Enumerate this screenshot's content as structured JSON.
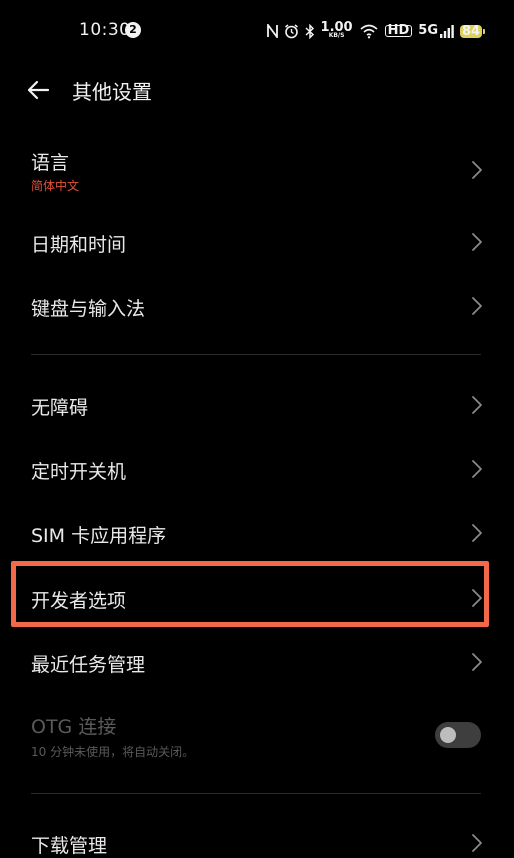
{
  "status_bar": {
    "time": "10:30",
    "notification_count": "2",
    "net_speed_value": "1.00",
    "net_speed_unit": "KB/S",
    "hd_label": "HD",
    "signal_5g": "5G",
    "battery_level": "84"
  },
  "header": {
    "title": "其他设置"
  },
  "items": [
    {
      "label": "语言",
      "sub": "简体中文"
    },
    {
      "label": "日期和时间"
    },
    {
      "label": "键盘与输入法"
    },
    {
      "label": "无障碍"
    },
    {
      "label": "定时开关机"
    },
    {
      "label": "SIM 卡应用程序"
    },
    {
      "label": "开发者选项"
    },
    {
      "label": "最近任务管理"
    },
    {
      "label": "OTG 连接",
      "sub": "10 分钟未使用，将自动关闭。",
      "toggle": "off"
    },
    {
      "label": "下载管理"
    }
  ],
  "colors": {
    "background": "#000000",
    "text": "#e9e9e9",
    "sub_accent": "#e0533b",
    "disabled_text": "#5a5a5a",
    "highlight": "#f4684a",
    "chevron": "#8a8a8a",
    "battery": "#dcd25a"
  }
}
